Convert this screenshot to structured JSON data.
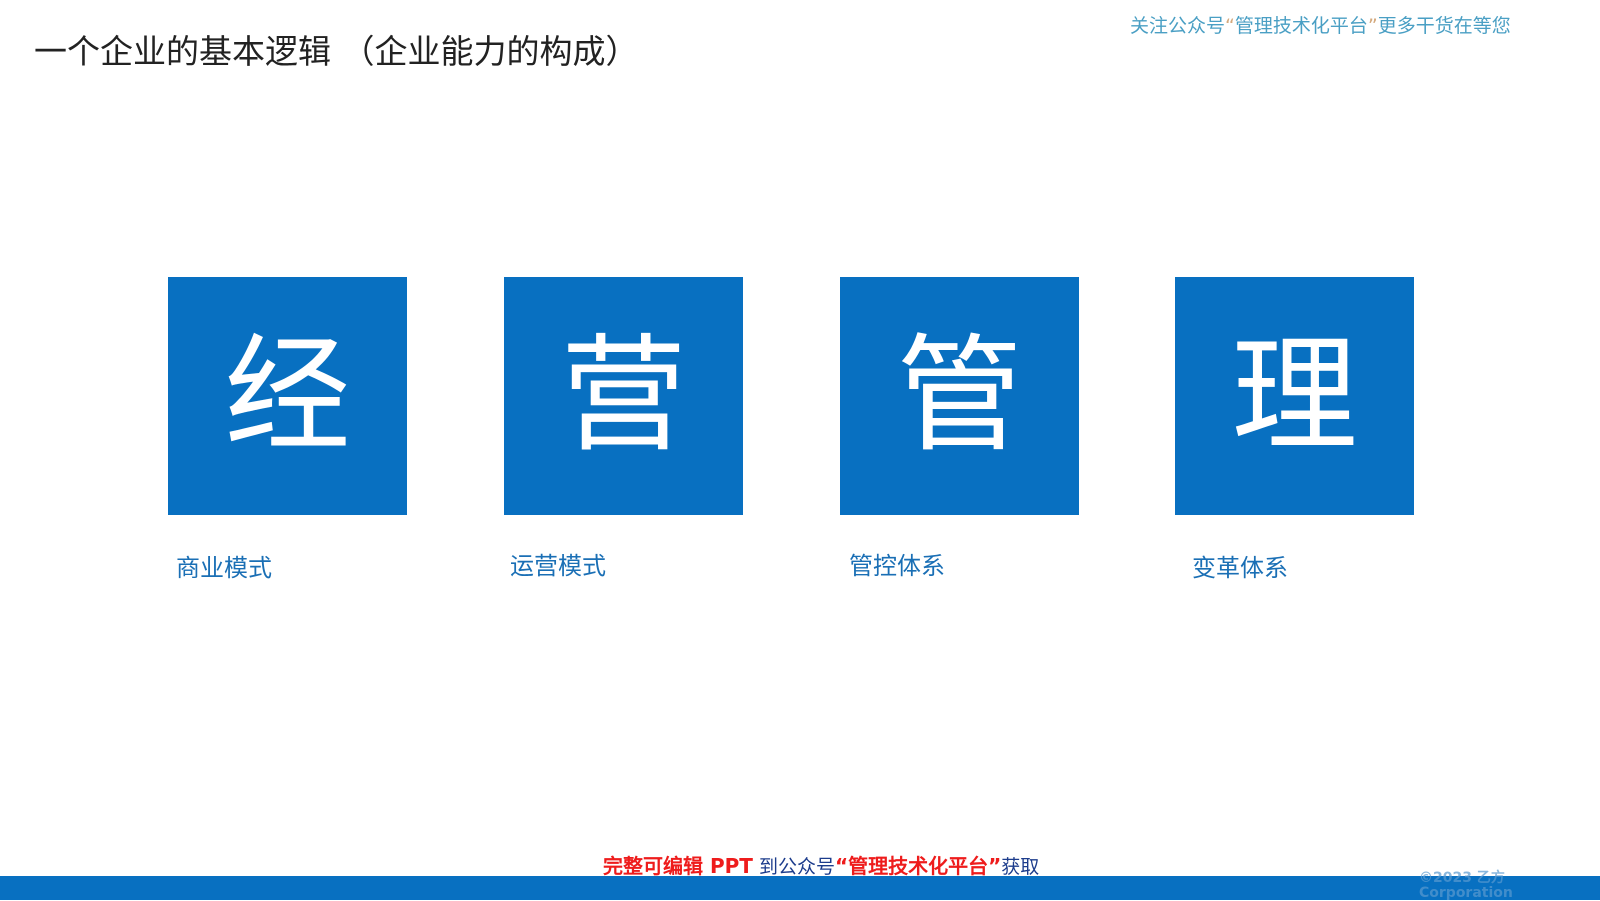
{
  "promo": {
    "prefix": "关注公众号",
    "open_quote": "“",
    "name": "管理技术化平台",
    "close_quote": "”",
    "suffix": "更多干货在等您"
  },
  "title": "一个企业的基本逻辑  （企业能力的构成）",
  "tiles": [
    {
      "char": "经",
      "caption": "商业模式"
    },
    {
      "char": "营",
      "caption": "运营模式"
    },
    {
      "char": "管",
      "caption": "管控体系"
    },
    {
      "char": "理",
      "caption": "变革体系"
    }
  ],
  "footer": {
    "highlight": "完整可编辑 PPT",
    "middle": " 到公众号",
    "open_quote": "“",
    "name": "管理技术化平台",
    "close_quote": "”",
    "end": "获取"
  },
  "copyright": {
    "line1": "©2023 乙方",
    "line2": "Corporation"
  },
  "colors": {
    "tile_bg": "#0870c1",
    "caption": "#1a6fb5",
    "bar": "#0870c1"
  }
}
